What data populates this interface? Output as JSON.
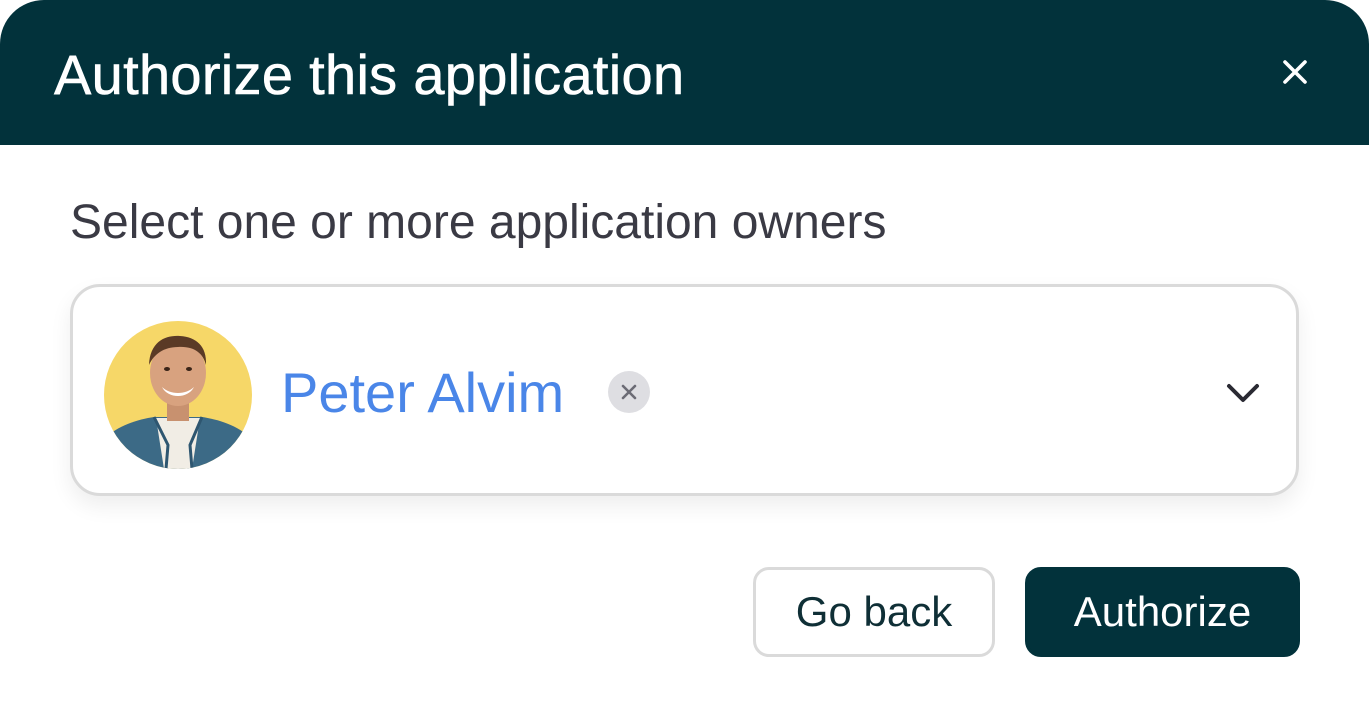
{
  "dialog": {
    "title": "Authorize this application",
    "close_icon": "close-icon"
  },
  "owners_field": {
    "label": "Select one or more application owners",
    "selected": [
      {
        "name": "Peter Alvim",
        "avatar": "user-avatar-photo",
        "remove_icon": "remove-chip-icon"
      }
    ],
    "dropdown_icon": "chevron-down-icon"
  },
  "actions": {
    "back_label": "Go back",
    "authorize_label": "Authorize"
  },
  "colors": {
    "header_bg": "#02323b",
    "primary_button": "#02323b",
    "chip_text": "#4a86e8",
    "border": "#dadada"
  }
}
